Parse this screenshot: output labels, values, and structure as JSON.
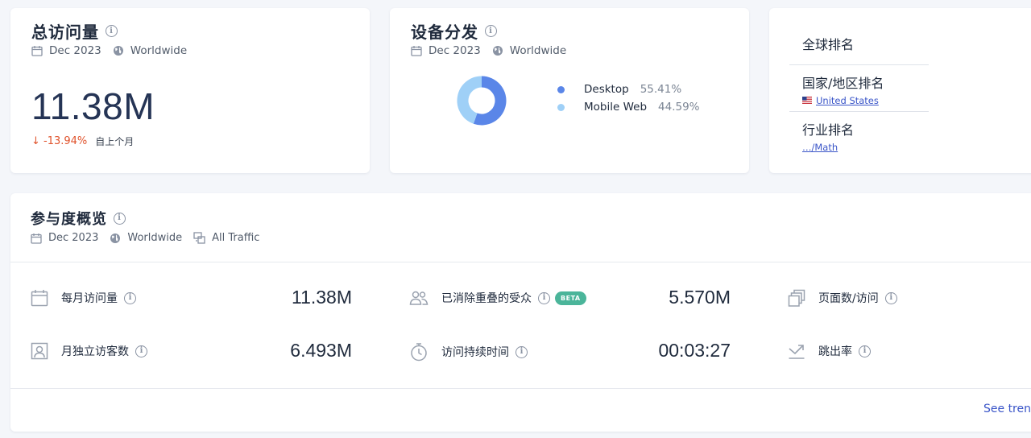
{
  "visits_card": {
    "title": "总访问量",
    "date": "Dec 2023",
    "region": "Worldwide",
    "value": "11.38M",
    "change": "↓ -13.94%",
    "change_ref": "自上个月"
  },
  "device_card": {
    "title": "设备分发",
    "date": "Dec 2023",
    "region": "Worldwide",
    "legend": [
      {
        "name": "Desktop",
        "pct": "55.41%",
        "color": "#5a86e8"
      },
      {
        "name": "Mobile Web",
        "pct": "44.59%",
        "color": "#9fd0f7"
      }
    ]
  },
  "chart_data": {
    "type": "pie",
    "categories": [
      "Desktop",
      "Mobile Web"
    ],
    "values": [
      55.41,
      44.59
    ],
    "colors": [
      "#5a86e8",
      "#9fd0f7"
    ],
    "donut": true
  },
  "rank_card": {
    "global_label": "全球排名",
    "country_label": "国家/地区排名",
    "country_link": "United States",
    "industry_label": "行业排名",
    "industry_link": "…/Math"
  },
  "engagement": {
    "title": "参与度概览",
    "date": "Dec 2023",
    "region": "Worldwide",
    "traffic": "All Traffic",
    "metrics": {
      "monthly_visits_label": "每月访问量",
      "monthly_visits_value": "11.38M",
      "dedup_audience_label": "已消除重叠的受众",
      "dedup_badge": "BETA",
      "dedup_audience_value": "5.570M",
      "pages_per_visit_label": "页面数/访问",
      "unique_visitors_label": "月独立访客数",
      "unique_visitors_value": "6.493M",
      "visit_duration_label": "访问持续时间",
      "visit_duration_value": "00:03:27",
      "bounce_rate_label": "跳出率"
    },
    "see_trend": "See trend"
  },
  "icons": {
    "info": "info-icon",
    "calendar": "calendar-icon",
    "globe": "globe-icon",
    "traffic": "traffic-icon",
    "audience": "audience-icon",
    "pages": "pages-icon",
    "visitor": "visitor-icon",
    "duration": "stopwatch-icon",
    "bounce": "bounce-arrow-icon"
  }
}
